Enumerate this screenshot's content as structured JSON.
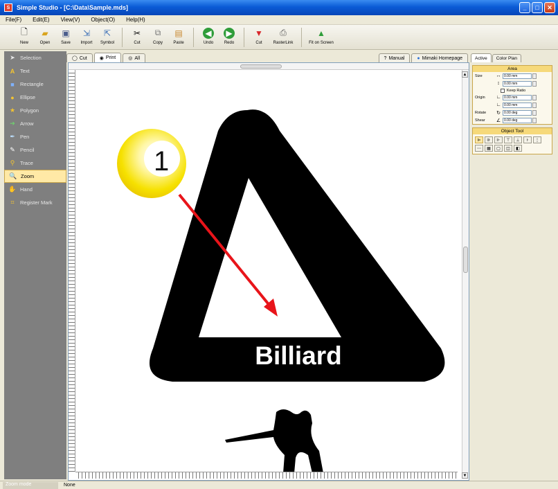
{
  "window": {
    "title": "Simple Studio - [C:\\Data\\Sample.mds]"
  },
  "menu": [
    "File(F)",
    "Edit(E)",
    "View(V)",
    "Object(O)",
    "Help(H)"
  ],
  "toolbar": [
    {
      "label": "New",
      "icon": "new-file-icon"
    },
    {
      "label": "Open",
      "icon": "folder-icon"
    },
    {
      "label": "Save",
      "icon": "save-icon"
    },
    {
      "label": "Import",
      "icon": "import-icon"
    },
    {
      "label": "Symbol",
      "icon": "symbol-icon"
    },
    {
      "label": "Cut",
      "icon": "scissors-icon"
    },
    {
      "label": "Copy",
      "icon": "copy-icon"
    },
    {
      "label": "Paste",
      "icon": "paste-icon"
    },
    {
      "label": "Undo",
      "icon": "undo-icon"
    },
    {
      "label": "Redo",
      "icon": "redo-icon"
    },
    {
      "label": "Cut",
      "icon": "cut-plotter-icon"
    },
    {
      "label": "RasterLink",
      "icon": "rasterlink-icon"
    },
    {
      "label": "Fit on Screen",
      "icon": "fit-icon"
    }
  ],
  "tools": [
    {
      "label": "Selection",
      "active": false
    },
    {
      "label": "Text",
      "active": false
    },
    {
      "label": "Rectangle",
      "active": false
    },
    {
      "label": "Ellipse",
      "active": false
    },
    {
      "label": "Polygon",
      "active": false
    },
    {
      "label": "Arrow",
      "active": false
    },
    {
      "label": "Pen",
      "active": false
    },
    {
      "label": "Pencil",
      "active": false
    },
    {
      "label": "Trace",
      "active": false
    },
    {
      "label": "Zoom",
      "active": true
    },
    {
      "label": "Hand",
      "active": false
    },
    {
      "label": "Register Mark",
      "active": false
    }
  ],
  "doc_tabs": {
    "cut": "Cut",
    "print": "Print",
    "all": "All",
    "manual": "Manual",
    "homepage": "Mimaki Homepage"
  },
  "artwork": {
    "badge_number": "1",
    "sign_text": "Billiard"
  },
  "right_panel": {
    "tabs": [
      "Active",
      "Color Plan"
    ],
    "area_title": "Area",
    "size_label": "Size",
    "origin_label": "Origin",
    "rotate_label": "Rotate",
    "shear_label": "Shear",
    "width": "0.00 mm",
    "height": "0.00 mm",
    "keep_ratio": "Keep Ratio",
    "origin_x": "0.00 mm",
    "origin_y": "0.00 mm",
    "rotate": "0.00 deg",
    "shear": "0.00 deg",
    "object_tool_title": "Object Tool"
  },
  "status": {
    "mode": "Zoom mode",
    "info": "None"
  },
  "colors": {
    "accent": "#ffe9a6",
    "titlebar": "#0a5bd6",
    "arrow": "#e8141a"
  }
}
